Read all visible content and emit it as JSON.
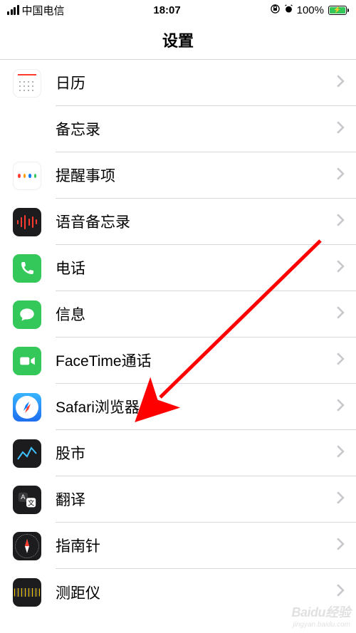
{
  "status": {
    "carrier": "中国电信",
    "time": "18:07",
    "battery_pct": "100%"
  },
  "nav": {
    "title": "设置"
  },
  "rows": [
    {
      "id": "calendar",
      "label": "日历"
    },
    {
      "id": "notes",
      "label": "备忘录"
    },
    {
      "id": "reminders",
      "label": "提醒事项"
    },
    {
      "id": "voicememos",
      "label": "语音备忘录"
    },
    {
      "id": "phone",
      "label": "电话"
    },
    {
      "id": "messages",
      "label": "信息"
    },
    {
      "id": "facetime",
      "label": "FaceTime通话"
    },
    {
      "id": "safari",
      "label": "Safari浏览器"
    },
    {
      "id": "stocks",
      "label": "股市"
    },
    {
      "id": "translate",
      "label": "翻译"
    },
    {
      "id": "compass",
      "label": "指南针"
    },
    {
      "id": "measure",
      "label": "测距仪"
    }
  ],
  "annotation": {
    "arrow_target_row": "safari"
  },
  "watermark": {
    "brand": "Baidu经验",
    "sub": "jingyan.baidu.com"
  }
}
